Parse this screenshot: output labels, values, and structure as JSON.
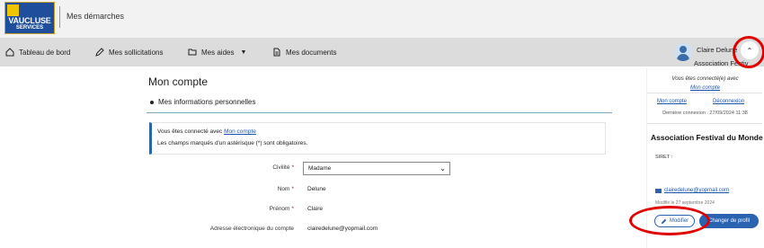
{
  "brand": {
    "line1": "VAUCLUSE",
    "line2": "SERVICES"
  },
  "header": {
    "title": "Mes démarches"
  },
  "nav": {
    "items": [
      {
        "label": "Tableau de bord",
        "icon": "home-icon"
      },
      {
        "label": "Mes sollicitations",
        "icon": "pen-icon"
      },
      {
        "label": "Mes aides",
        "icon": "folder-icon"
      },
      {
        "label": "Mes documents",
        "icon": "document-icon"
      }
    ]
  },
  "user": {
    "name": "Claire Delune",
    "org": "Association Festiv"
  },
  "main": {
    "page_title": "Mon compte",
    "section_title": "Mes informations personnelles",
    "info": {
      "connected_prefix": "Vous êtes connecté avec",
      "connected_link": "Mon compte",
      "required_note": "Les champs marqués d'un astérisque (*) sont obligatoires."
    },
    "form": {
      "civility_label": "Civilité",
      "civility_value": "Madame",
      "lastname_label": "Nom",
      "lastname_value": "Delune",
      "firstname_label": "Prénom",
      "firstname_value": "Claire",
      "email_label": "Adresse électronique du compte",
      "email_value": "clairedelune@yopmail.com",
      "required_mark": "*"
    }
  },
  "panel": {
    "connected_text": "Vous êtes connecté(e) avec",
    "connected_link": "Mon compte",
    "link_account": "Mon compte",
    "link_logout": "Déconnexion",
    "last_login": "Dernière connexion : 27/09/2024 11:38",
    "org_name": "Association Festival du Monde",
    "siret_label": "SIRET :",
    "email": "clairedelune@yopmail.com",
    "modified": "Modifié le 27 septembre 2024",
    "btn_modify": "Modifier",
    "btn_change_profile": "Changer de profil"
  },
  "colors": {
    "accent": "#2a63b0",
    "annotation": "#e00000",
    "nav_bg": "#dcdcdc"
  }
}
